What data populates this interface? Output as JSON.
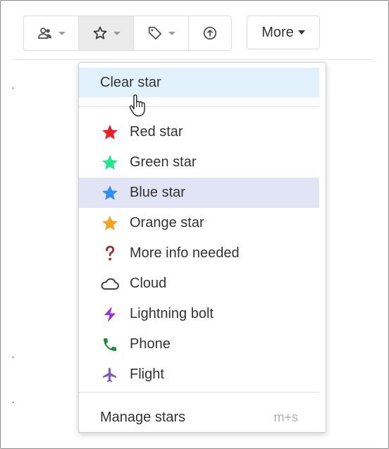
{
  "toolbar": {
    "buttons": [
      {
        "icon": "people-icon"
      },
      {
        "icon": "star-outline-icon",
        "active": true
      },
      {
        "icon": "tag-icon"
      },
      {
        "icon": "upload-icon"
      }
    ],
    "more_label": "More"
  },
  "menu": {
    "clear_label": "Clear star",
    "items": [
      {
        "label": "Red star",
        "icon": "red-star-icon",
        "color": "#ee1c25"
      },
      {
        "label": "Green star",
        "icon": "green-star-icon",
        "color": "#1de88c"
      },
      {
        "label": "Blue star",
        "icon": "blue-star-icon",
        "color": "#2f8ff5",
        "highlighted": true
      },
      {
        "label": "Orange star",
        "icon": "orange-star-icon",
        "color": "#f7a21b"
      },
      {
        "label": "More info needed",
        "icon": "question-mark-icon",
        "color": "#9a2d2d"
      },
      {
        "label": "Cloud",
        "icon": "cloud-icon",
        "color": "#444444"
      },
      {
        "label": "Lightning bolt",
        "icon": "lightning-bolt-icon",
        "color": "#9d2be0"
      },
      {
        "label": "Phone",
        "icon": "phone-icon",
        "color": "#1e8e3e"
      },
      {
        "label": "Flight",
        "icon": "flight-icon",
        "color": "#7e57c2"
      }
    ],
    "manage_label": "Manage stars",
    "manage_shortcut": "m+s"
  }
}
